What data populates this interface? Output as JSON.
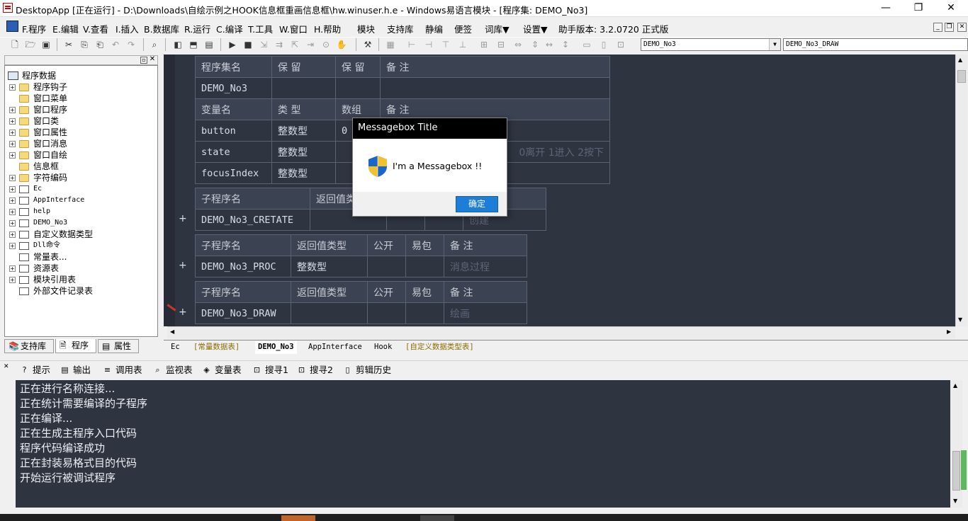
{
  "window": {
    "title": "DesktopApp [正在运行] - D:\\Downloads\\自绘示例之HOOK信息框重画信息框\\hw.winuser.h.e - Windows易语言模块 - [程序集: DEMO_No3]",
    "min": "—",
    "max": "❐",
    "close": "✕"
  },
  "menu": {
    "items": [
      "F.程序",
      "E.编辑",
      "V.查看",
      "I.插入",
      "B.数据库",
      "R.运行",
      "C.编译",
      "T.工具",
      "W.窗口",
      "H.帮助",
      "模块",
      "支持库",
      "静编",
      "便签",
      "词库▼",
      "设置▼",
      "助手版本: 3.2.0720 正式版"
    ],
    "mdi": [
      "_",
      "❐",
      "✕"
    ]
  },
  "toolbar": {
    "combo1": "DEMO_No3",
    "combo2": "DEMO_No3_DRAW",
    "combo_arrow": "▼"
  },
  "tree": {
    "root": "程序数据",
    "items": [
      {
        "label": "程序钩子",
        "icon": "folder-icon",
        "expand": "+"
      },
      {
        "label": "窗口菜单",
        "icon": "folder-icon",
        "expand": ""
      },
      {
        "label": "窗口程序",
        "icon": "folder-icon",
        "expand": "+"
      },
      {
        "label": "窗口类",
        "icon": "folder-icon",
        "expand": "+"
      },
      {
        "label": "窗口属性",
        "icon": "folder-icon",
        "expand": "+"
      },
      {
        "label": "窗口消息",
        "icon": "folder-icon",
        "expand": "+"
      },
      {
        "label": "窗口自绘",
        "icon": "folder-icon",
        "expand": "+"
      },
      {
        "label": "信息框",
        "icon": "folder-icon",
        "expand": ""
      },
      {
        "label": "字符编码",
        "icon": "folder-icon",
        "expand": "+"
      },
      {
        "label": "Ec",
        "icon": "module-icon",
        "expand": "+"
      },
      {
        "label": "AppInterface",
        "icon": "module-icon",
        "expand": "+"
      },
      {
        "label": "help",
        "icon": "module-icon",
        "expand": "+"
      },
      {
        "label": "DEMO_No3",
        "icon": "module-icon",
        "expand": "+"
      },
      {
        "label": "自定义数据类型",
        "icon": "datatype-icon",
        "expand": "+"
      },
      {
        "label": "Dll命令",
        "icon": "dll-icon",
        "expand": "+"
      },
      {
        "label": "常量表...",
        "icon": "constant-icon",
        "expand": ""
      },
      {
        "label": "资源表",
        "icon": "resource-icon",
        "expand": "+"
      },
      {
        "label": "模块引用表",
        "icon": "module-ref-icon",
        "expand": "+"
      },
      {
        "label": "外部文件记录表",
        "icon": "file-icon",
        "expand": ""
      }
    ],
    "tabs": [
      "支持库",
      "程序",
      "属性"
    ]
  },
  "editor": {
    "assembly_header": [
      "程序集名",
      "保 留",
      "保 留",
      "备 注"
    ],
    "assembly_row": [
      "DEMO_No3",
      "",
      "",
      ""
    ],
    "var_header": [
      "变量名",
      "类 型",
      "数组",
      "备 注"
    ],
    "vars": [
      [
        "button",
        "整数型",
        "0",
        ""
      ],
      [
        "state",
        "整数型",
        "",
        "0离开 1进入 2按下"
      ],
      [
        "focusIndex",
        "整数型",
        "",
        ""
      ]
    ],
    "sub_header": [
      "子程序名",
      "返回值类型",
      "公开",
      "易包",
      "备 注"
    ],
    "subs": [
      {
        "cells": [
          "DEMO_No3_CRETATE",
          "",
          "",
          "",
          "创建"
        ],
        "marker": "+"
      },
      {
        "cells": [
          "DEMO_No3_PROC",
          "整数型",
          "",
          "",
          "消息过程"
        ],
        "marker": "+"
      },
      {
        "cells": [
          "DEMO_No3_DRAW",
          "",
          "",
          "",
          "绘画"
        ],
        "marker": "+"
      }
    ]
  },
  "file_tabs": [
    "Ec",
    "[常量数据表]",
    "DEMO_No3",
    "AppInterface",
    "Hook",
    "[自定义数据类型表]"
  ],
  "bottom_tabs": [
    "提示",
    "输出",
    "调用表",
    "监视表",
    "变量表",
    "搜寻1",
    "搜寻2",
    "剪辑历史"
  ],
  "output_lines": [
    "正在进行名称连接...",
    "正在统计需要编译的子程序",
    "正在编译...",
    "正在生成主程序入口代码",
    "程序代码编译成功",
    "正在封装易格式目的代码",
    "开始运行被调试程序"
  ],
  "messagebox": {
    "title": "Messagebox Title",
    "text": "I'm a Messagebox !!",
    "ok": "确定",
    "icon": "shield-icon"
  },
  "colors": {
    "editor_bg": "#2e3440",
    "accent": "#1e7dd7"
  }
}
